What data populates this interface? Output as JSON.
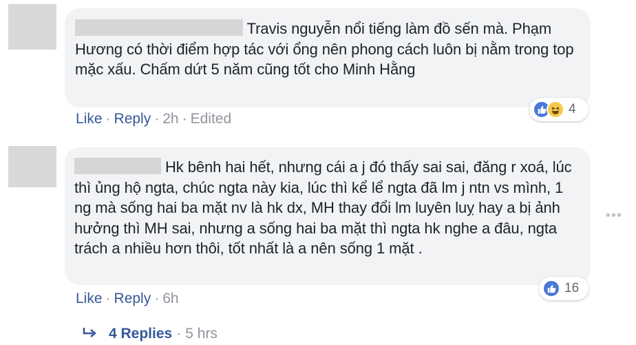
{
  "comments": [
    {
      "text": "Travis nguyễn nổi tiếng làm đồ sến mà. Phạm Hương có thời điểm hợp tác với ổng nên phong cách luôn bị nằm trong top mặc xấu. Chấm dứt 5 năm cũng tốt cho Minh Hằng",
      "like_label": "Like",
      "reply_label": "Reply",
      "time": "2h",
      "edited_label": "Edited",
      "reaction_count": "4",
      "reaction_icons": [
        "like-icon",
        "haha-icon"
      ]
    },
    {
      "text": "Hk bênh hai hết, nhưng cái a j đó thấy sai sai, đăng r xoá, lúc thì ủng hộ ngta, chúc ngta này kia, lúc thì kể lể ngta đã lm j ntn vs mình, 1 ng mà sống hai ba mặt nv là hk dx, MH thay đổi lm luyên luỵ hay a bị ảnh hưởng thì MH sai, nhưng a sống hai ba mặt thì ngta hk nghe a đâu, ngta trách a nhiều hơn thôi, tốt nhất là a nên sống 1 mặt .",
      "like_label": "Like",
      "reply_label": "Reply",
      "time": "6h",
      "reaction_count": "16",
      "reaction_icons": [
        "like-icon"
      ],
      "more_label": "•••"
    }
  ],
  "replies": {
    "label": "4 Replies",
    "time": "5 hrs"
  },
  "colors": {
    "link": "#365899",
    "muted": "#90949c",
    "bubble": "#f2f3f5",
    "like": "#4a78d6",
    "haha": "#f7c94b"
  }
}
